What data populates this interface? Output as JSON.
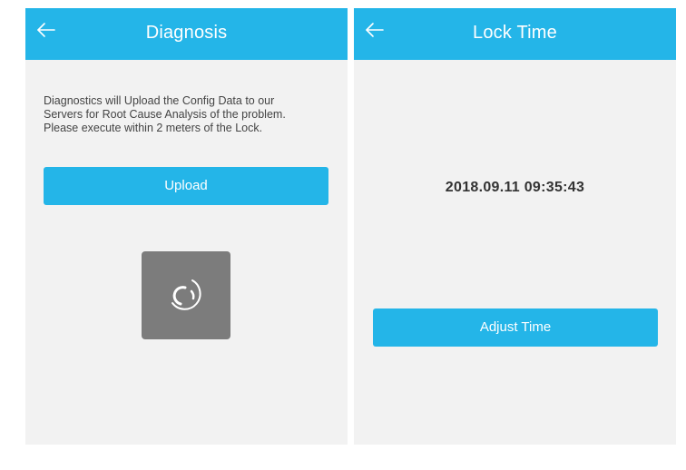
{
  "colors": {
    "accent": "#24b5e8",
    "screen_background": "#f2f2f2",
    "loader_background": "#7c7c7c",
    "text_dark": "#333333"
  },
  "diagnosis_screen": {
    "title": "Diagnosis",
    "back_icon": "arrow-left-icon",
    "description_lines": [
      "Diagnostics will Upload the Config Data to our",
      "Servers for Root Cause Analysis of the problem.",
      "Please execute within 2 meters of the Lock."
    ],
    "upload_label": "Upload",
    "loader_icon": "spinner-icon"
  },
  "lock_time_screen": {
    "title": "Lock Time",
    "back_icon": "arrow-left-icon",
    "current_time": "2018.09.11 09:35:43",
    "adjust_label": "Adjust Time"
  }
}
